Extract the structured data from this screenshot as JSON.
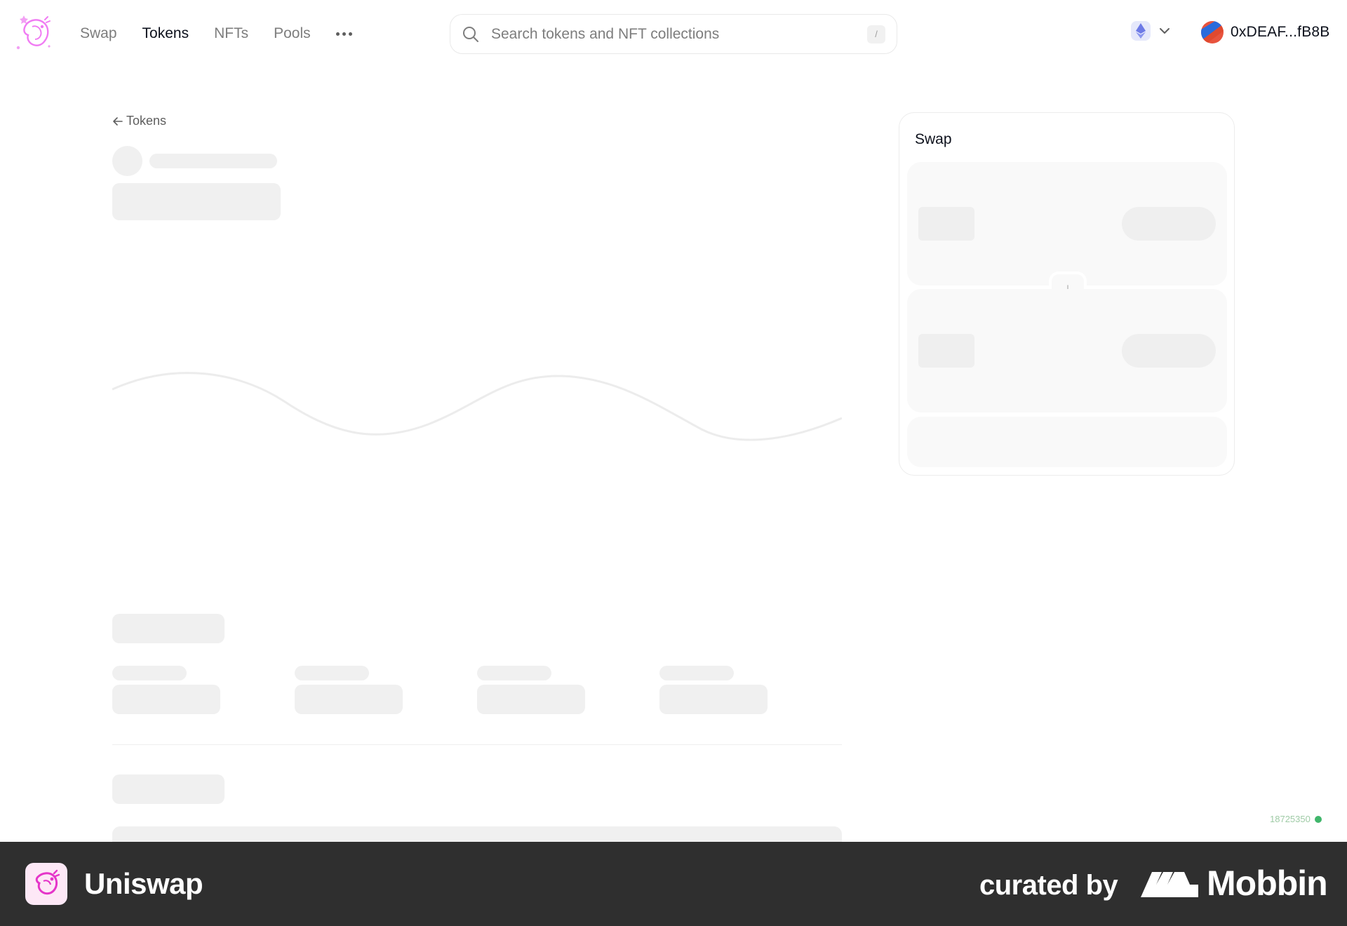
{
  "nav": {
    "items": [
      {
        "label": "Swap",
        "active": false
      },
      {
        "label": "Tokens",
        "active": true
      },
      {
        "label": "NFTs",
        "active": false
      },
      {
        "label": "Pools",
        "active": false
      }
    ],
    "more_icon": "more-horizontal-icon"
  },
  "search": {
    "placeholder": "Search tokens and NFT collections",
    "value": "",
    "shortcut": "/"
  },
  "chain": {
    "icon": "ethereum-icon",
    "dropdown_icon": "chevron-down-icon"
  },
  "account": {
    "address": "0xDEAF...fB8B"
  },
  "breadcrumb": {
    "back_label": "Tokens"
  },
  "swap_panel": {
    "title": "Swap",
    "arrow_icon": "arrow-down-icon"
  },
  "block_status": {
    "number": "18725350",
    "status_color": "#40b66b"
  },
  "footer": {
    "app_name": "Uniswap",
    "curated_by": "curated by",
    "brand": "Mobbin"
  },
  "colors": {
    "accent": "#fc72ff",
    "skeleton": "#f0f0f0",
    "footer_bg": "#2f2f2f"
  }
}
